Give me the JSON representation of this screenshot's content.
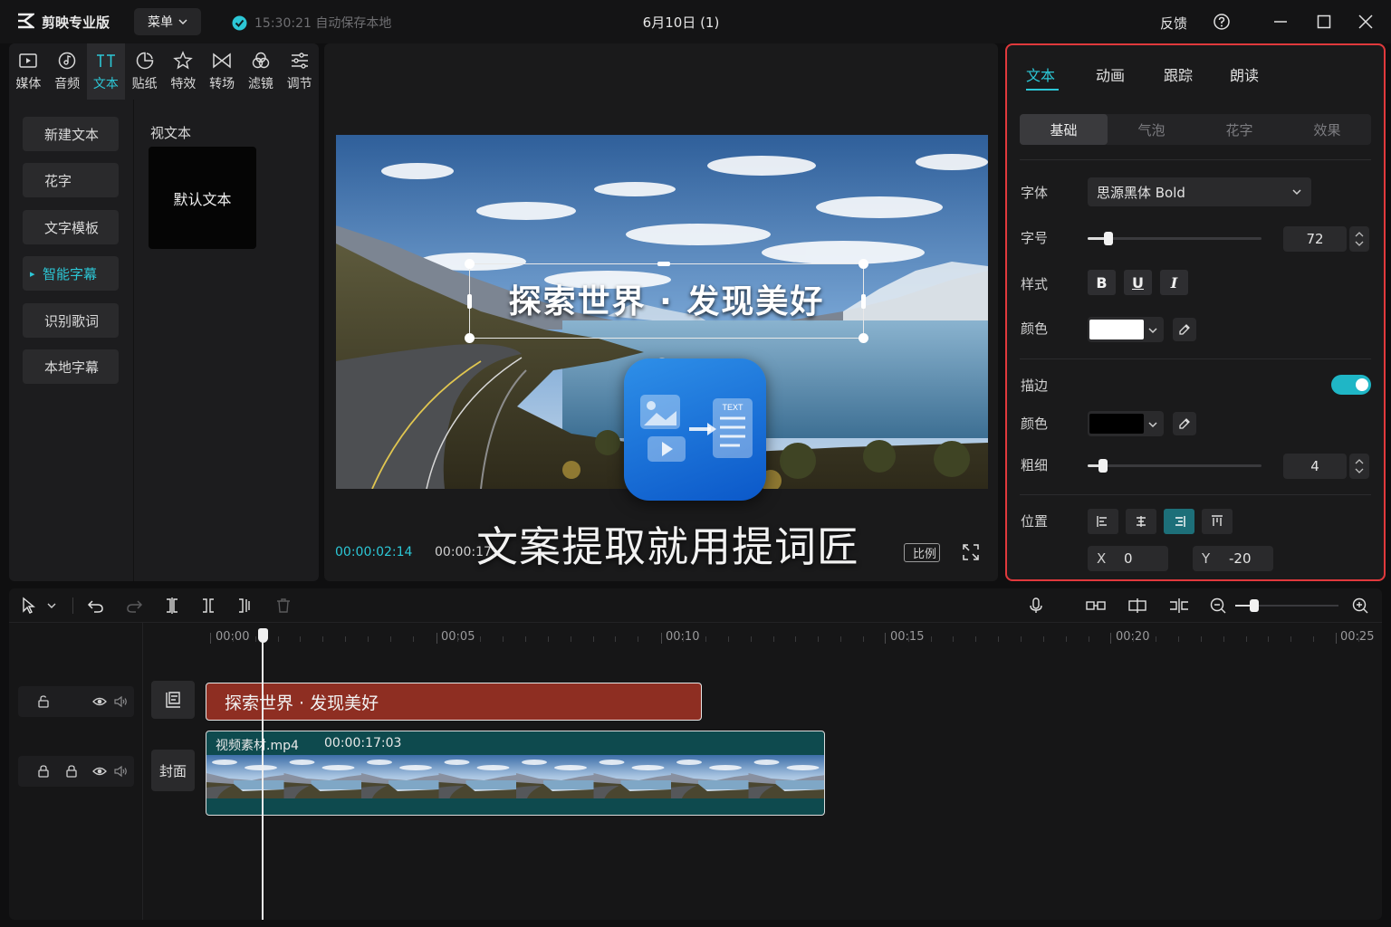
{
  "titlebar": {
    "app_name": "剪映专业版",
    "menu_label": "菜单",
    "save_status": "15:30:21 自动保存本地",
    "doc_title": "6月10日 (1)",
    "feedback": "反馈"
  },
  "toolbar": {
    "tabs": [
      {
        "label": "媒体",
        "icon": "media-icon"
      },
      {
        "label": "音频",
        "icon": "audio-icon"
      },
      {
        "label": "文本",
        "icon": "text-icon",
        "active": true
      },
      {
        "label": "贴纸",
        "icon": "sticker-icon"
      },
      {
        "label": "特效",
        "icon": "effects-icon"
      },
      {
        "label": "转场",
        "icon": "transition-icon"
      },
      {
        "label": "滤镜",
        "icon": "filter-icon"
      },
      {
        "label": "调节",
        "icon": "adjust-icon"
      }
    ]
  },
  "text_nav": {
    "items": [
      "新建文本",
      "花字",
      "文字模板",
      "智能字幕",
      "识别歌词",
      "本地字幕"
    ],
    "active_index": 3
  },
  "text_list": {
    "section_label": "视文本",
    "card_label": "默认文本"
  },
  "player": {
    "caption": "探索世界 · 发现美好",
    "watermark": "文案提取就用提词匠",
    "current_time": "00:00:02:14",
    "total_time": "00:00:17:",
    "ratio_label": "比例"
  },
  "inspector": {
    "tabs": [
      "文本",
      "动画",
      "跟踪",
      "朗读"
    ],
    "sub_tabs": [
      "基础",
      "气泡",
      "花字",
      "效果"
    ],
    "font_label": "字体",
    "font_value": "思源黑体 Bold",
    "size_label": "字号",
    "size_value": "72",
    "size_fraction": 0.12,
    "style_label": "样式",
    "style_buttons": [
      "B",
      "U",
      "I"
    ],
    "color_label": "颜色",
    "text_color": "#ffffff",
    "stroke_label": "描边",
    "stroke_enabled": true,
    "stroke_color_label": "颜色",
    "stroke_color": "#000000",
    "thickness_label": "粗细",
    "thickness_value": "4",
    "thickness_fraction": 0.09,
    "position_label": "位置",
    "x_label": "X",
    "x_value": "0",
    "y_label": "Y",
    "y_value": "-20",
    "accent": "#2cc7d6"
  },
  "timeline": {
    "ruler": [
      "00:00",
      "00:05",
      "00:10",
      "00:15",
      "00:20",
      "00:25"
    ],
    "text_clip": "探索世界 · 发现美好",
    "video_clip_name": "视频素材.mp4",
    "video_clip_duration": "00:00:17:03",
    "cover_label": "封面"
  }
}
